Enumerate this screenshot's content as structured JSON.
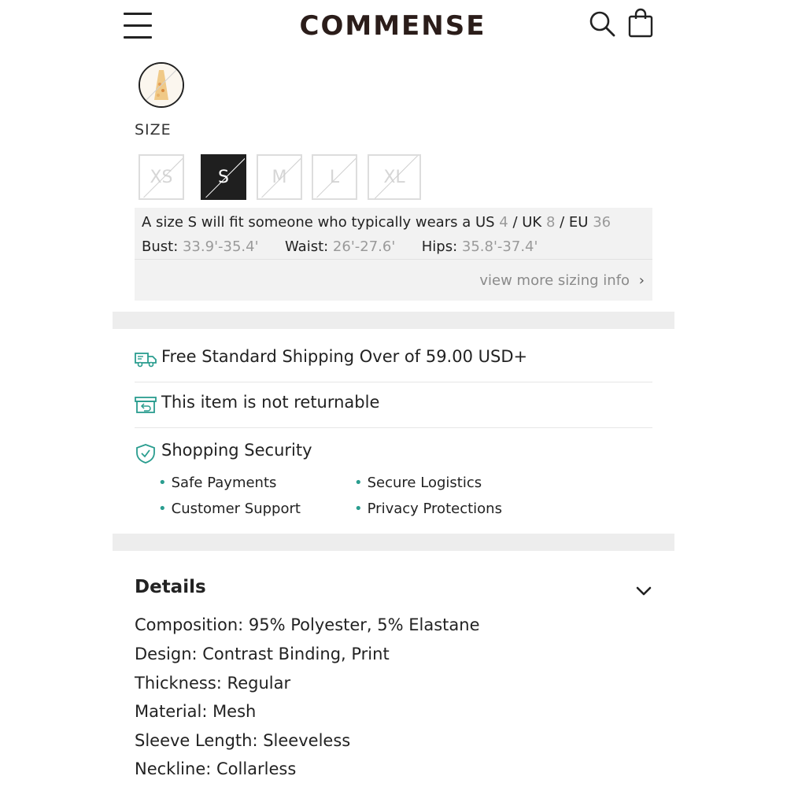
{
  "header": {
    "logo": "COMMENSE",
    "icons": [
      "menu-icon",
      "search-icon",
      "shopping-bag-icon"
    ]
  },
  "size": {
    "label": "SIZE",
    "options": [
      "XS",
      "S",
      "M",
      "L",
      "XL"
    ],
    "selected": "S"
  },
  "fit": {
    "prefix": "A size S will fit someone who typically wears a ",
    "us_label": "US ",
    "us_value": "4",
    "uk_label": " / UK ",
    "uk_value": "8",
    "eu_label": " / EU ",
    "eu_value": "36",
    "bust_label": "Bust: ",
    "bust_value": "33.9'-35.4'",
    "waist_label": "Waist: ",
    "waist_value": "26'-27.6'",
    "hips_label": "Hips: ",
    "hips_value": "35.8'-37.4'",
    "more_link": "view more sizing info"
  },
  "services": {
    "shipping": "Free Standard Shipping Over of 59.00 USD+",
    "returns": "This item is not returnable",
    "security_title": "Shopping Security",
    "security_items": [
      "Safe Payments",
      "Secure Logistics",
      "Customer Support",
      "Privacy Protections"
    ]
  },
  "details": {
    "title": "Details",
    "lines": [
      "Composition: 95% Polyester, 5% Elastane",
      "Design: Contrast Binding, Print",
      "Thickness: Regular",
      "Material: Mesh",
      "Sleeve Length: Sleeveless",
      "Neckline: Collarless"
    ]
  },
  "colors": {
    "accent": "#2a9d8f",
    "selected_size_bg": "#1f1f1f",
    "logo": "#2b1d1a"
  }
}
